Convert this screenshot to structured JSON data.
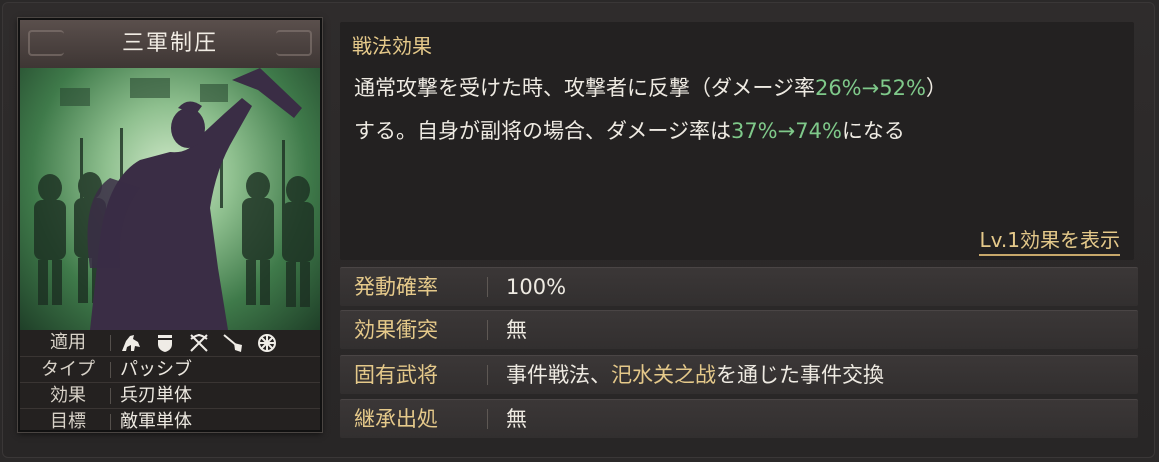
{
  "card": {
    "title": "三軍制圧",
    "stats": [
      {
        "label": "適用"
      },
      {
        "label": "タイプ",
        "value": "パッシブ"
      },
      {
        "label": "効果",
        "value": "兵刃単体"
      },
      {
        "label": "目標",
        "value": "敵軍単体"
      }
    ],
    "applicable_icons": [
      "cavalry-icon",
      "shield-icon",
      "crossed-bows-icon",
      "spear-icon",
      "wheel-icon"
    ]
  },
  "effect": {
    "heading": "戦法効果",
    "line1_prefix": "通常攻撃を受けた時、攻撃者に反撃（ダメージ率",
    "line1_value": "26%→52%",
    "line1_suffix": "）",
    "line2_prefix": "する。自身が副将の場合、ダメージ率は",
    "line2_value": "37%→74%",
    "line2_suffix": "になる",
    "lv_link": "Lv.1効果を表示"
  },
  "info": [
    {
      "label": "発動確率",
      "value": "100%"
    },
    {
      "label": "効果衝突",
      "value": "無"
    },
    {
      "label": "固有武将",
      "value_prefix": "事件戦法、",
      "value_highlight": "汜水关之战",
      "value_suffix": "を通じた事件交換"
    },
    {
      "label": "継承出処",
      "value": "無"
    }
  ],
  "colors": {
    "accent_gold": "#e5c98a",
    "value_green": "#7fc98a",
    "background": "#2b2929"
  }
}
